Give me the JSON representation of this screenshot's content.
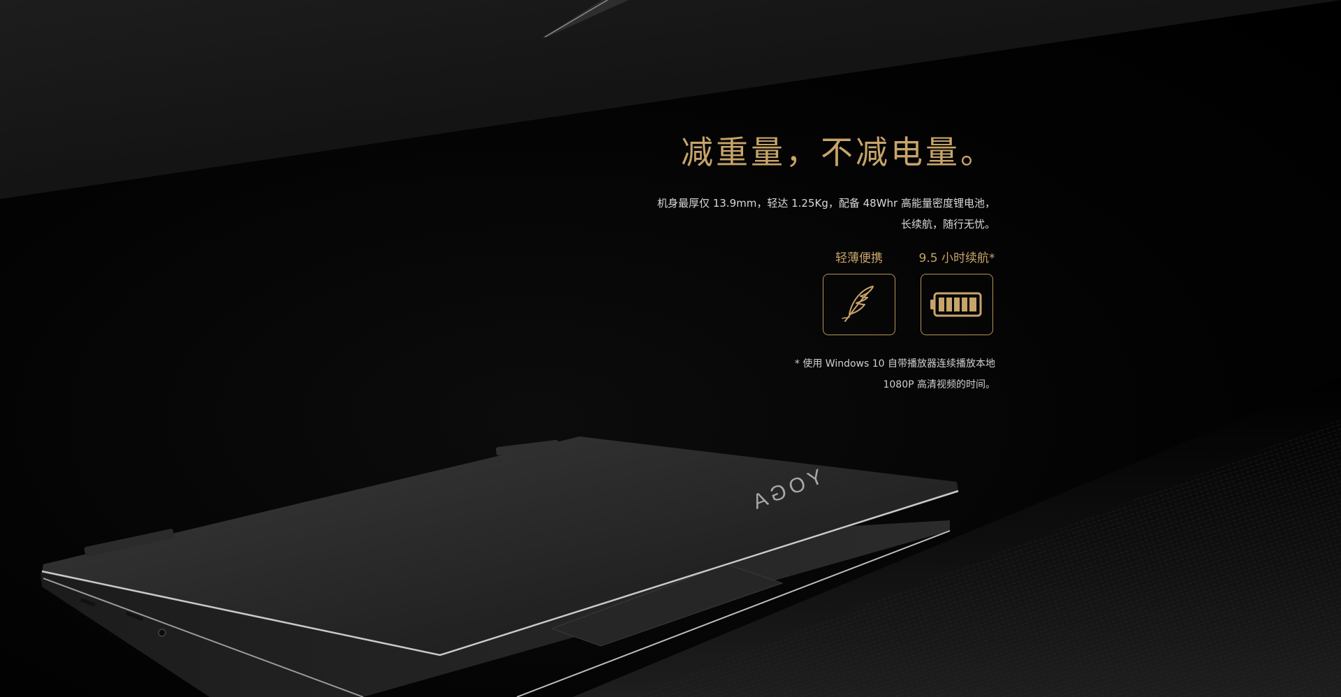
{
  "headline": "减重量，不减电量。",
  "description": {
    "line1": "机身最厚仅 13.9mm，轻达 1.25Kg，配备 48Whr 高能量密度锂电池，",
    "line2": "长续航，随行无忧。"
  },
  "features": [
    {
      "label": "轻薄便携",
      "icon": "feather-icon"
    },
    {
      "label": "9.5 小时续航*",
      "icon": "battery-icon"
    }
  ],
  "footnote": {
    "line1": "* 使用 Windows 10 自带播放器连续播放本地",
    "line2": "1080P 高清视频的时间。"
  },
  "product": {
    "lid_logo": "YOGA"
  },
  "colors": {
    "accent_gold": "#c7a46a",
    "background": "#000000",
    "body_text": "#d9d9d9"
  }
}
